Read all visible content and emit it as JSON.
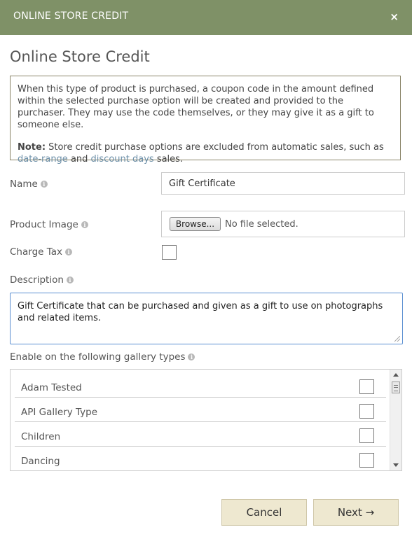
{
  "window": {
    "title": "ONLINE STORE CREDIT",
    "close_icon": "×"
  },
  "page": {
    "heading": "Online Store Credit"
  },
  "info": {
    "paragraph": "When this type of product is purchased, a coupon code in the amount defined within the selected purchase option will be created and provided to the purchaser. They may use the code themselves, or they may give it as a gift to someone else.",
    "note_label": "Note:",
    "note_text_1": " Store credit purchase options are excluded from automatic sales, such as",
    "link_date_range": "date-range",
    "note_and": " and ",
    "link_discount_days": "discount days",
    "note_text_2": " sales."
  },
  "form": {
    "name_label": "Name",
    "name_value": "Gift Certificate",
    "image_label": "Product Image",
    "browse_label": "Browse...",
    "no_file_text": "No file selected.",
    "tax_label": "Charge Tax",
    "tax_checked": false,
    "description_label": "Description",
    "description_value": "Gift Certificate that can be purchased and given as a gift to use on photographs and related items.",
    "gallery_label": "Enable on the following gallery types"
  },
  "gallery_types": [
    {
      "label": "Adam Tested",
      "checked": false
    },
    {
      "label": "API Gallery Type",
      "checked": false
    },
    {
      "label": "Children",
      "checked": false
    },
    {
      "label": "Dancing",
      "checked": false
    }
  ],
  "buttons": {
    "cancel": "Cancel",
    "next": "Next →"
  },
  "colors": {
    "titlebar": "#7f9167",
    "button_bg": "#eee8d0",
    "link": "#6c8fa8",
    "focus_border": "#5b8fd1"
  }
}
